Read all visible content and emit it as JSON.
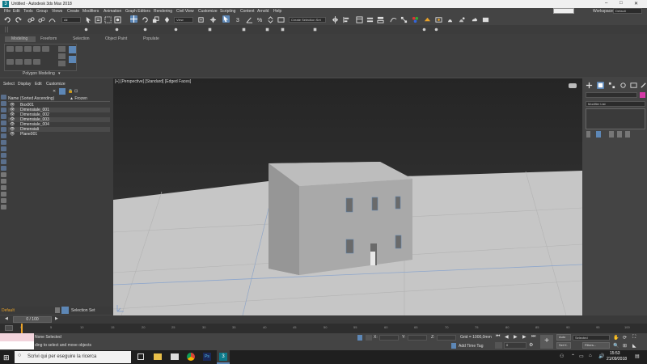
{
  "window": {
    "title": "Untitled - Autodesk 3ds Max 2018"
  },
  "menu": [
    "File",
    "Edit",
    "Tools",
    "Group",
    "Views",
    "Create",
    "Modifiers",
    "Animation",
    "Graph Editors",
    "Rendering",
    "Civil View",
    "Customize",
    "Scripting",
    "Content",
    "Arnold",
    "Help"
  ],
  "toolbar": {
    "filter_value": "All",
    "refcoord_value": "View",
    "selection_set_value": "Create Selection Set",
    "workspaces_label": "Workspaces:",
    "workspace_value": "Default"
  },
  "ribbon": {
    "tabs": [
      "Modeling",
      "Freeform",
      "Selection",
      "Object Paint",
      "Populate"
    ],
    "panel_label": "Polygon Modeling"
  },
  "scene_explorer": {
    "menu": [
      "Select",
      "Display",
      "Edit",
      "Customize"
    ],
    "header_name": "Name (Sorted Ascending)",
    "header_frozen": "▲ Frozen",
    "rows": [
      "Box001",
      "Dimensiale_001",
      "Dimensiale_002",
      "Dimensiale_003",
      "Dimensiale_004",
      "Dimensiali",
      "Plane001"
    ],
    "layer_value": "Default",
    "selection_set_label": "Selection Set"
  },
  "viewport": {
    "label": "[+] [Perspective] [Standard] [Edged Faces]"
  },
  "command_panel": {
    "modifier_list": "Modifier List"
  },
  "timeline": {
    "slider_label": "0 / 100",
    "ticks": [
      "0",
      "5",
      "10",
      "15",
      "20",
      "25",
      "30",
      "35",
      "40",
      "45",
      "50",
      "55",
      "60",
      "65",
      "70",
      "75",
      "80",
      "85",
      "90",
      "95",
      "100"
    ]
  },
  "status": {
    "selection_text": "None Selected",
    "prompt_text": "ding to select and move objects",
    "x_label": "X:",
    "y_label": "Y:",
    "z_label": "Z:",
    "grid_text": "Grid = 1000,0mm",
    "add_time_tag": "Add Time Tag",
    "auto_label": "Auto",
    "setk_label": "Set K.",
    "selected_value": "Selected",
    "filters_label": "Filters...",
    "frame_value": "0"
  },
  "taskbar": {
    "search_placeholder": "Scrivi qui per eseguire la ricerca",
    "time": "15:53",
    "date": "21/09/2018"
  },
  "colors": {
    "accent": "#5d87b6",
    "viewport_bg": "#2a2a2a",
    "ground": "#c6c6c6"
  }
}
